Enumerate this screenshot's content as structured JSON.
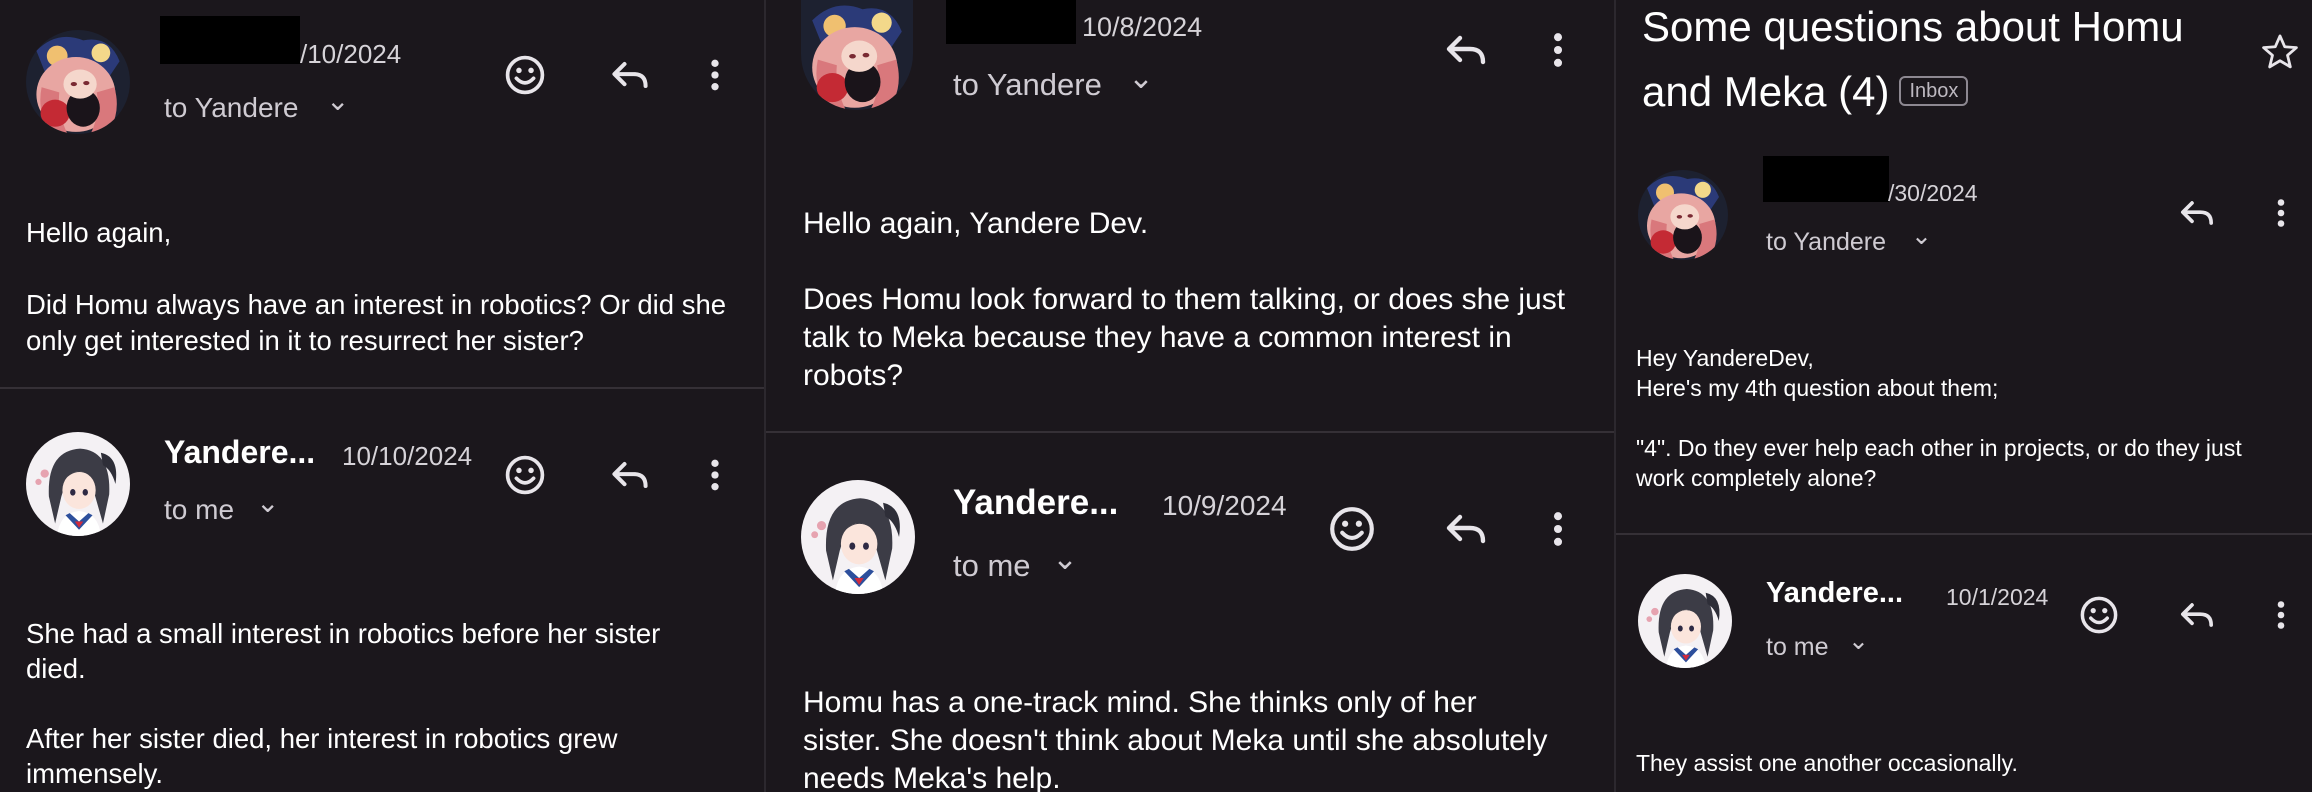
{
  "panel1": {
    "msg1": {
      "date": "/10/2024",
      "to_line": "to Yandere",
      "chevron": "⌄",
      "body": [
        "Hello again,",
        "Did Homu always have an interest in robotics? Or did she only get interested in it to resurrect her sister?"
      ]
    },
    "msg2": {
      "sender": "Yandere...",
      "date": "10/10/2024",
      "to_line": "to me",
      "chevron": "⌄",
      "body": [
        "She had a small interest in robotics before her sister died.",
        "After her sister died, her interest in robotics grew immensely."
      ]
    }
  },
  "panel2": {
    "msg1": {
      "date": "10/8/2024",
      "to_line": "to Yandere",
      "chevron": "⌄",
      "body": [
        "Hello again, Yandere Dev.",
        "Does Homu look forward to them talking, or does she just talk to Meka because they have a common interest in robots?"
      ]
    },
    "msg2": {
      "sender": "Yandere...",
      "date": "10/9/2024",
      "to_line": "to me",
      "chevron": "⌄",
      "body": [
        "Homu has a one-track mind. She thinks only of her sister. She doesn't think about Meka until she absolutely needs Meka's help."
      ]
    }
  },
  "panel3": {
    "subject": "Some questions about Homu and Meka (4)",
    "badge": "Inbox",
    "msg1": {
      "date": "/30/2024",
      "to_line": "to Yandere",
      "chevron": "⌄",
      "body": [
        "Hey YandereDev,\nHere's my 4th question about them;",
        "\"4\". Do they ever help each other in projects, or do they just work completely alone?"
      ]
    },
    "msg2": {
      "sender": "Yandere...",
      "date": "10/1/2024",
      "to_line": "to me",
      "chevron": "⌄",
      "body": [
        "They assist one another occasionally."
      ]
    }
  },
  "icons": {
    "emoji": "smiley-face-icon",
    "reply": "reply-arrow-icon",
    "more": "more-vertical-icon",
    "star": "star-outline-icon"
  },
  "colors": {
    "background": "#1b171c",
    "text": "#ffffff",
    "secondary_text": "#cfcbd2",
    "divider": "#353036"
  }
}
